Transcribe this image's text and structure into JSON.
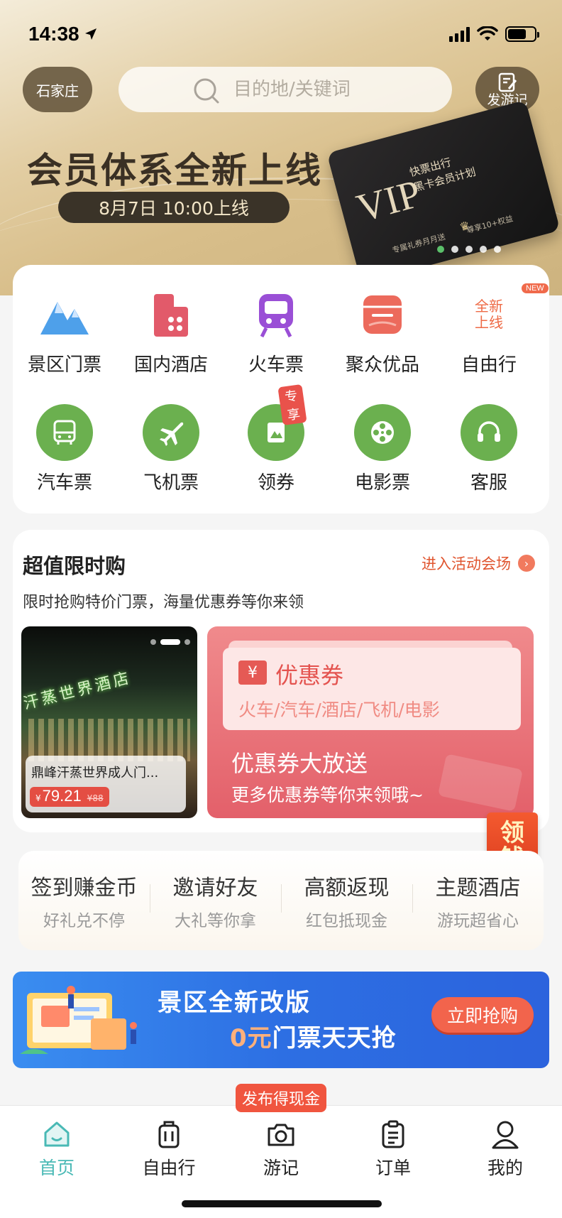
{
  "status": {
    "time": "14:38"
  },
  "header": {
    "city": "石家庄",
    "search_placeholder": "目的地/关键词",
    "write_label": "发游记"
  },
  "promo": {
    "title": "会员体系全新上线",
    "date": "8月7日 10:00上线",
    "vip": {
      "big": "VIP",
      "line1": "快票出行",
      "line2": "黑卡会员计划",
      "foot": "专属礼券月月送",
      "perk": "尊享10+权益"
    },
    "carousel_count": 5,
    "carousel_active": 1
  },
  "categories": {
    "row1": [
      {
        "label": "景区门票",
        "icon": "mountain-icon"
      },
      {
        "label": "国内酒店",
        "icon": "hotel-icon"
      },
      {
        "label": "火车票",
        "icon": "train-icon"
      },
      {
        "label": "聚众优品",
        "icon": "shop-icon"
      },
      {
        "label": "自由行",
        "icon": "new-online-badge",
        "new_line1": "全新",
        "new_line2": "上线",
        "tag": "NEW"
      }
    ],
    "row2": [
      {
        "label": "汽车票",
        "icon": "bus-icon"
      },
      {
        "label": "飞机票",
        "icon": "plane-icon"
      },
      {
        "label": "领券",
        "icon": "coupon-icon",
        "tag": "专享"
      },
      {
        "label": "电影票",
        "icon": "film-reel-icon"
      },
      {
        "label": "客服",
        "icon": "headset-icon"
      }
    ],
    "colors": {
      "green": "#6bb04f"
    }
  },
  "flash_sale": {
    "title": "超值限时购",
    "more": "进入活动会场",
    "desc": "限时抢购特价门票，海量优惠券等你来领",
    "hotel_card": {
      "sign": "汗蒸世界酒店",
      "name": "鼎峰汗蒸世界成人门...",
      "currency": "¥",
      "price": "79.21",
      "original": "¥88"
    },
    "coupon_card": {
      "yen": "¥",
      "title": "优惠券",
      "scope": "火车/汽车/酒店/飞机/电影",
      "headline": "优惠券大放送",
      "sub": "更多优惠券等你来领哦~"
    }
  },
  "envelope": {
    "line1": "领",
    "line2": "钱"
  },
  "quick": [
    {
      "title": "签到赚金币",
      "sub": "好礼兑不停"
    },
    {
      "title": "邀请好友",
      "sub": "大礼等你拿"
    },
    {
      "title": "高额返现",
      "sub": "红包抵现金"
    },
    {
      "title": "主题酒店",
      "sub": "游玩超省心"
    }
  ],
  "banner": {
    "line1": "景区全新改版",
    "zero": "0元",
    "line2_rest": "门票天天抢",
    "button": "立即抢购"
  },
  "tabbar": {
    "post_badge": "发布得现金",
    "tabs": [
      {
        "label": "首页",
        "icon": "home-icon",
        "active": true
      },
      {
        "label": "自由行",
        "icon": "suitcase-icon"
      },
      {
        "label": "游记",
        "icon": "camera-icon"
      },
      {
        "label": "订单",
        "icon": "clipboard-icon"
      },
      {
        "label": "我的",
        "icon": "user-icon"
      }
    ],
    "active_color": "#49b9b5"
  }
}
